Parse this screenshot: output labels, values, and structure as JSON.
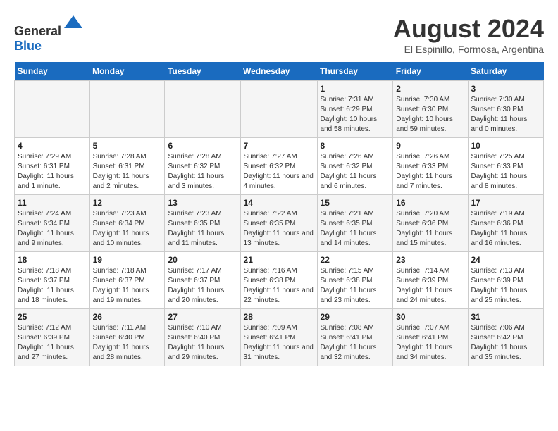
{
  "header": {
    "logo_general": "General",
    "logo_blue": "Blue",
    "month_title": "August 2024",
    "subtitle": "El Espinillo, Formosa, Argentina"
  },
  "days_of_week": [
    "Sunday",
    "Monday",
    "Tuesday",
    "Wednesday",
    "Thursday",
    "Friday",
    "Saturday"
  ],
  "weeks": [
    [
      {
        "day": "",
        "sunrise": "",
        "sunset": "",
        "daylight": ""
      },
      {
        "day": "",
        "sunrise": "",
        "sunset": "",
        "daylight": ""
      },
      {
        "day": "",
        "sunrise": "",
        "sunset": "",
        "daylight": ""
      },
      {
        "day": "",
        "sunrise": "",
        "sunset": "",
        "daylight": ""
      },
      {
        "day": "1",
        "sunrise": "Sunrise: 7:31 AM",
        "sunset": "Sunset: 6:29 PM",
        "daylight": "Daylight: 10 hours and 58 minutes."
      },
      {
        "day": "2",
        "sunrise": "Sunrise: 7:30 AM",
        "sunset": "Sunset: 6:30 PM",
        "daylight": "Daylight: 10 hours and 59 minutes."
      },
      {
        "day": "3",
        "sunrise": "Sunrise: 7:30 AM",
        "sunset": "Sunset: 6:30 PM",
        "daylight": "Daylight: 11 hours and 0 minutes."
      }
    ],
    [
      {
        "day": "4",
        "sunrise": "Sunrise: 7:29 AM",
        "sunset": "Sunset: 6:31 PM",
        "daylight": "Daylight: 11 hours and 1 minute."
      },
      {
        "day": "5",
        "sunrise": "Sunrise: 7:28 AM",
        "sunset": "Sunset: 6:31 PM",
        "daylight": "Daylight: 11 hours and 2 minutes."
      },
      {
        "day": "6",
        "sunrise": "Sunrise: 7:28 AM",
        "sunset": "Sunset: 6:32 PM",
        "daylight": "Daylight: 11 hours and 3 minutes."
      },
      {
        "day": "7",
        "sunrise": "Sunrise: 7:27 AM",
        "sunset": "Sunset: 6:32 PM",
        "daylight": "Daylight: 11 hours and 4 minutes."
      },
      {
        "day": "8",
        "sunrise": "Sunrise: 7:26 AM",
        "sunset": "Sunset: 6:32 PM",
        "daylight": "Daylight: 11 hours and 6 minutes."
      },
      {
        "day": "9",
        "sunrise": "Sunrise: 7:26 AM",
        "sunset": "Sunset: 6:33 PM",
        "daylight": "Daylight: 11 hours and 7 minutes."
      },
      {
        "day": "10",
        "sunrise": "Sunrise: 7:25 AM",
        "sunset": "Sunset: 6:33 PM",
        "daylight": "Daylight: 11 hours and 8 minutes."
      }
    ],
    [
      {
        "day": "11",
        "sunrise": "Sunrise: 7:24 AM",
        "sunset": "Sunset: 6:34 PM",
        "daylight": "Daylight: 11 hours and 9 minutes."
      },
      {
        "day": "12",
        "sunrise": "Sunrise: 7:23 AM",
        "sunset": "Sunset: 6:34 PM",
        "daylight": "Daylight: 11 hours and 10 minutes."
      },
      {
        "day": "13",
        "sunrise": "Sunrise: 7:23 AM",
        "sunset": "Sunset: 6:35 PM",
        "daylight": "Daylight: 11 hours and 11 minutes."
      },
      {
        "day": "14",
        "sunrise": "Sunrise: 7:22 AM",
        "sunset": "Sunset: 6:35 PM",
        "daylight": "Daylight: 11 hours and 13 minutes."
      },
      {
        "day": "15",
        "sunrise": "Sunrise: 7:21 AM",
        "sunset": "Sunset: 6:35 PM",
        "daylight": "Daylight: 11 hours and 14 minutes."
      },
      {
        "day": "16",
        "sunrise": "Sunrise: 7:20 AM",
        "sunset": "Sunset: 6:36 PM",
        "daylight": "Daylight: 11 hours and 15 minutes."
      },
      {
        "day": "17",
        "sunrise": "Sunrise: 7:19 AM",
        "sunset": "Sunset: 6:36 PM",
        "daylight": "Daylight: 11 hours and 16 minutes."
      }
    ],
    [
      {
        "day": "18",
        "sunrise": "Sunrise: 7:18 AM",
        "sunset": "Sunset: 6:37 PM",
        "daylight": "Daylight: 11 hours and 18 minutes."
      },
      {
        "day": "19",
        "sunrise": "Sunrise: 7:18 AM",
        "sunset": "Sunset: 6:37 PM",
        "daylight": "Daylight: 11 hours and 19 minutes."
      },
      {
        "day": "20",
        "sunrise": "Sunrise: 7:17 AM",
        "sunset": "Sunset: 6:37 PM",
        "daylight": "Daylight: 11 hours and 20 minutes."
      },
      {
        "day": "21",
        "sunrise": "Sunrise: 7:16 AM",
        "sunset": "Sunset: 6:38 PM",
        "daylight": "Daylight: 11 hours and 22 minutes."
      },
      {
        "day": "22",
        "sunrise": "Sunrise: 7:15 AM",
        "sunset": "Sunset: 6:38 PM",
        "daylight": "Daylight: 11 hours and 23 minutes."
      },
      {
        "day": "23",
        "sunrise": "Sunrise: 7:14 AM",
        "sunset": "Sunset: 6:39 PM",
        "daylight": "Daylight: 11 hours and 24 minutes."
      },
      {
        "day": "24",
        "sunrise": "Sunrise: 7:13 AM",
        "sunset": "Sunset: 6:39 PM",
        "daylight": "Daylight: 11 hours and 25 minutes."
      }
    ],
    [
      {
        "day": "25",
        "sunrise": "Sunrise: 7:12 AM",
        "sunset": "Sunset: 6:39 PM",
        "daylight": "Daylight: 11 hours and 27 minutes."
      },
      {
        "day": "26",
        "sunrise": "Sunrise: 7:11 AM",
        "sunset": "Sunset: 6:40 PM",
        "daylight": "Daylight: 11 hours and 28 minutes."
      },
      {
        "day": "27",
        "sunrise": "Sunrise: 7:10 AM",
        "sunset": "Sunset: 6:40 PM",
        "daylight": "Daylight: 11 hours and 29 minutes."
      },
      {
        "day": "28",
        "sunrise": "Sunrise: 7:09 AM",
        "sunset": "Sunset: 6:41 PM",
        "daylight": "Daylight: 11 hours and 31 minutes."
      },
      {
        "day": "29",
        "sunrise": "Sunrise: 7:08 AM",
        "sunset": "Sunset: 6:41 PM",
        "daylight": "Daylight: 11 hours and 32 minutes."
      },
      {
        "day": "30",
        "sunrise": "Sunrise: 7:07 AM",
        "sunset": "Sunset: 6:41 PM",
        "daylight": "Daylight: 11 hours and 34 minutes."
      },
      {
        "day": "31",
        "sunrise": "Sunrise: 7:06 AM",
        "sunset": "Sunset: 6:42 PM",
        "daylight": "Daylight: 11 hours and 35 minutes."
      }
    ]
  ]
}
